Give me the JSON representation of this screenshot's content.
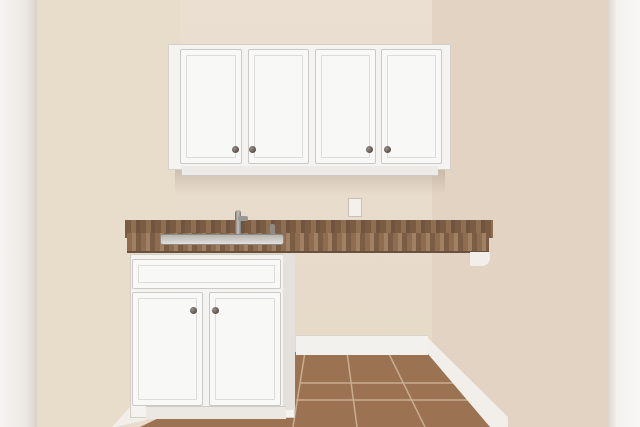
{
  "scene": {
    "description_label": "",
    "colors": {
      "wall": "#e8dccd",
      "wall_right": "#e3d3c3",
      "cabinet": "#f8f8f6",
      "countertop": "#8a6a4c",
      "floor_tile": "#9b7253",
      "trim": "#f3f1ee"
    },
    "objects": [
      "upper-cabinets",
      "countertop",
      "sink",
      "faucet",
      "base-cabinet",
      "wall-outlet",
      "tile-floor",
      "baseboard",
      "door-frame"
    ]
  }
}
